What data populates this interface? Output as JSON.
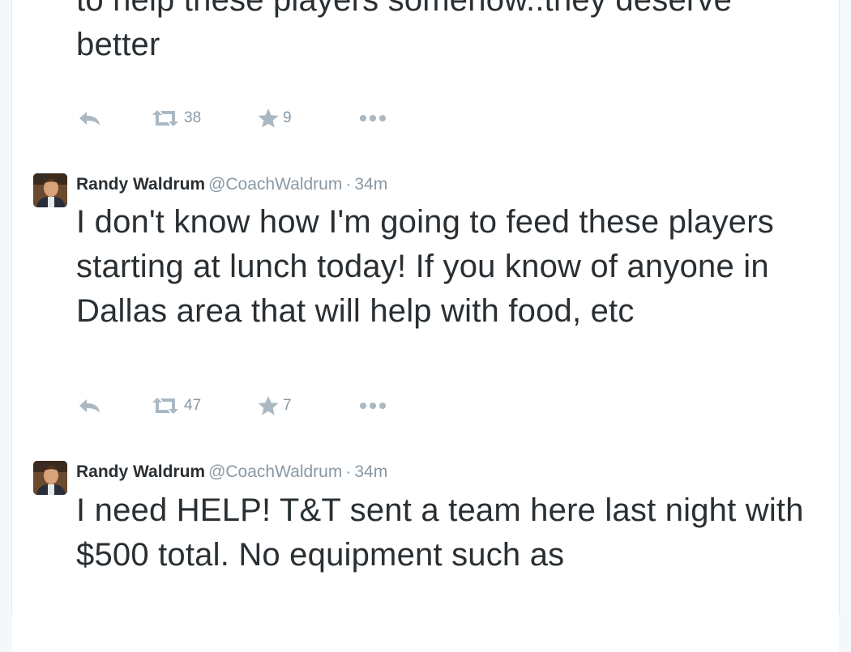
{
  "tweets": [
    {
      "author_name": "",
      "handle": "",
      "time": "",
      "text": "to help these players somehow..they deserve better",
      "retweets": "38",
      "favorites": "9"
    },
    {
      "author_name": "Randy Waldrum",
      "handle": "@CoachWaldrum",
      "separator": "·",
      "time": "34m",
      "text": "I don't know how I'm going to feed these players starting at lunch today! If you know of anyone in Dallas area that will help with food, etc",
      "retweets": "47",
      "favorites": "7"
    },
    {
      "author_name": "Randy Waldrum",
      "handle": "@CoachWaldrum",
      "separator": "·",
      "time": "34m",
      "text": "I need HELP! T&T sent a team here last night with $500 total.  No equipment such as"
    }
  ],
  "colors": {
    "text": "#292f33",
    "secondary": "#8899a6",
    "icon": "#aab8c2",
    "border": "#e1e8ed",
    "background": "#f5f8fa"
  },
  "icons": [
    "reply-icon",
    "retweet-icon",
    "favorite-star-icon",
    "more-options-icon"
  ]
}
